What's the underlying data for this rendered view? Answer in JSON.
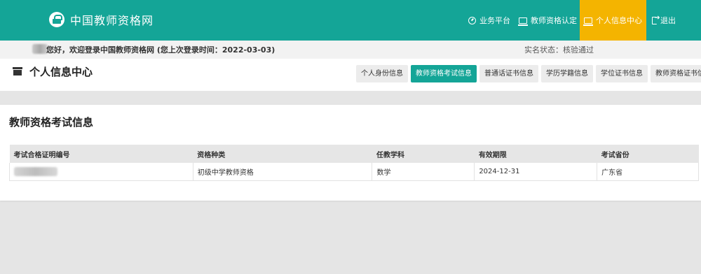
{
  "site": {
    "title": "中国教师资格网"
  },
  "nav": {
    "items": [
      {
        "label": "业务平台",
        "icon": "dashboard-icon"
      },
      {
        "label": "教师资格认定",
        "icon": "monitor-icon"
      },
      {
        "label": "个人信息中心",
        "icon": "monitor-icon",
        "active": true
      },
      {
        "label": "退出",
        "icon": "logout-icon"
      }
    ]
  },
  "greeting": {
    "text": "您好，欢迎登录中国教师资格网 (您上次登录时间：2022-03-03)",
    "verify_status": "实名状态：核验通过"
  },
  "header": {
    "title": "个人信息中心",
    "tabs": [
      {
        "label": "个人身份信息"
      },
      {
        "label": "教师资格考试信息",
        "active": true
      },
      {
        "label": "普通话证书信息"
      },
      {
        "label": "学历学籍信息"
      },
      {
        "label": "学位证书信息"
      },
      {
        "label": "教师资格证书信息"
      }
    ]
  },
  "panel": {
    "title": "教师资格考试信息",
    "columns": [
      "考试合格证明编号",
      "资格种类",
      "任教学科",
      "有效期限",
      "考试省份"
    ],
    "rows": [
      {
        "cert_no": "",
        "type": "初级中学教师资格",
        "subject": "数学",
        "valid_until": "2024-12-31",
        "province": "广东省"
      }
    ]
  },
  "colors": {
    "primary": "#14a597",
    "accent": "#f4b400",
    "background": "#e5e5e5"
  }
}
